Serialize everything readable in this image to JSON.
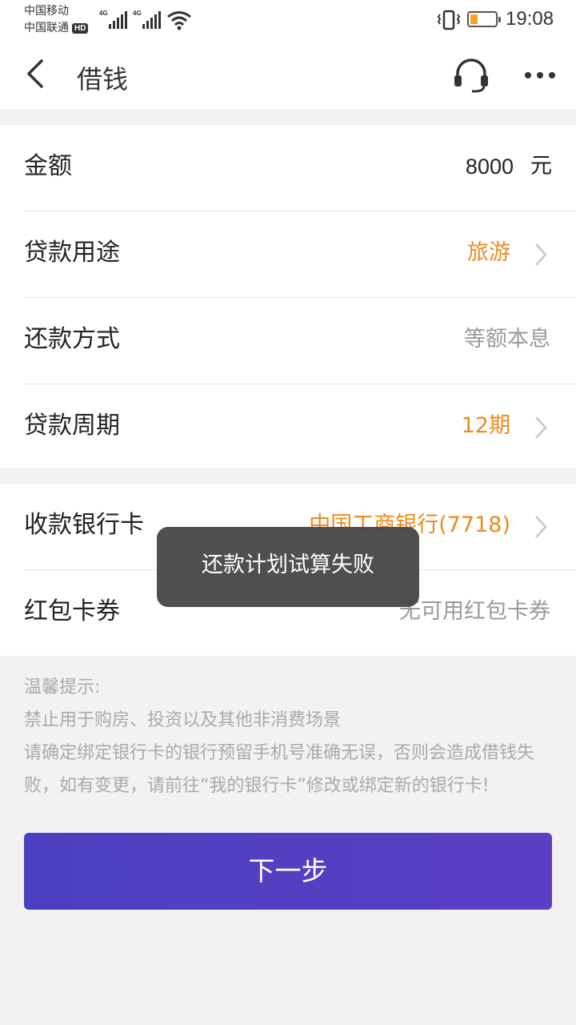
{
  "status_bar": {
    "carrier1": "中国移动",
    "carrier2": "中国联通",
    "hd_badge": "HD",
    "network1": "4G",
    "network2": "4G",
    "battery_level": 0.3,
    "time": "19:08"
  },
  "header": {
    "title": "借钱"
  },
  "form": {
    "amount": {
      "label": "金额",
      "value": "8000",
      "unit": "元"
    },
    "purpose": {
      "label": "贷款用途",
      "value": "旅游"
    },
    "repayment_method": {
      "label": "还款方式",
      "value": "等额本息"
    },
    "term": {
      "label": "贷款周期",
      "value": "12期"
    },
    "bank_card": {
      "label": "收款银行卡",
      "value": "中国工商银行(7718)"
    },
    "coupon": {
      "label": "红包卡券",
      "value": "无可用红包卡券"
    }
  },
  "tips": {
    "title": "温馨提示:",
    "line1": "禁止用于购房、投资以及其他非消费场景",
    "line2": "请确定绑定银行卡的银行预留手机号准确无误，否则会造成借钱失败，如有变更，请前往“我的银行卡”修改或绑定新的银行卡!"
  },
  "next_button": {
    "label": "下一步"
  },
  "toast": {
    "message": "还款计划试算失败"
  },
  "colors": {
    "accent_orange": "#ef8a1c",
    "button_purple": "#4a3fc0",
    "battery_orange": "#f5a623"
  }
}
